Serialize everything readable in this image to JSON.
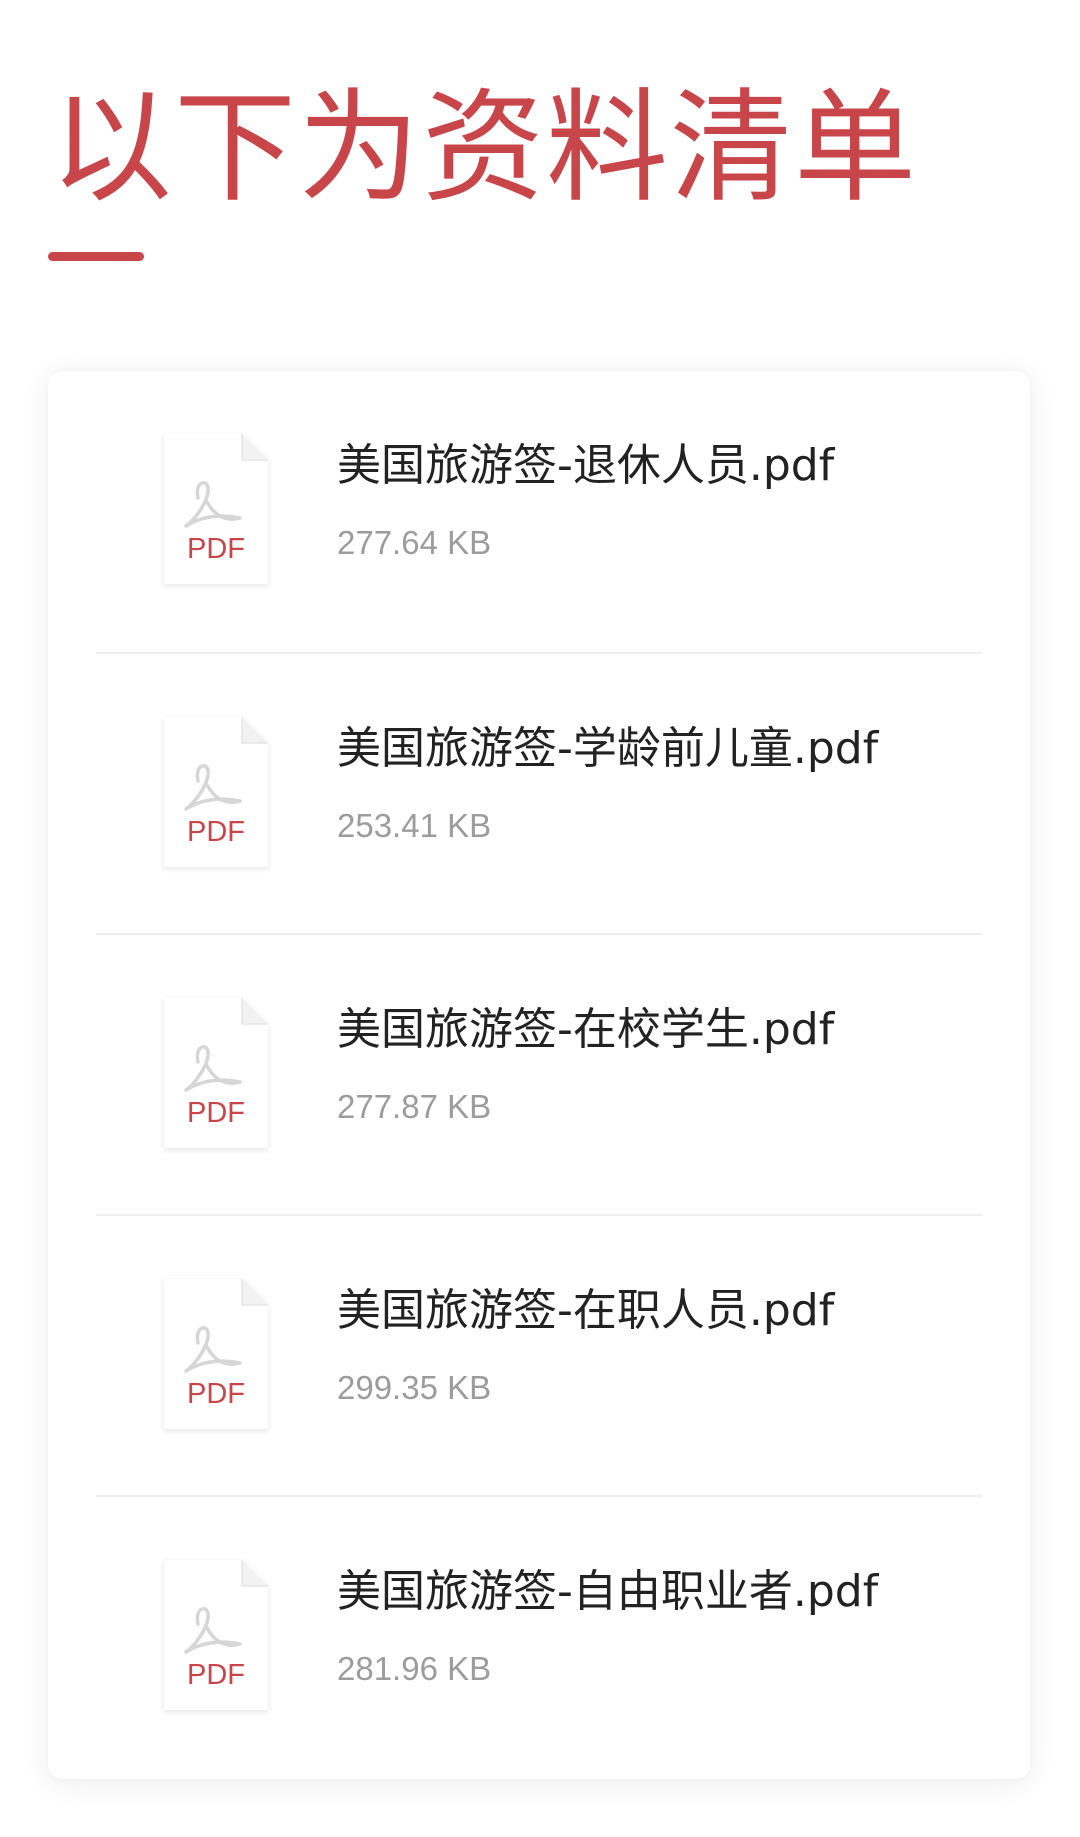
{
  "header": {
    "title": "以下为资料清单"
  },
  "colors": {
    "accent": "#c8454a",
    "pdf_label": "#c8454a",
    "file_size": "#9c9c9c",
    "file_name": "#222222"
  },
  "files": [
    {
      "name": "美国旅游签-退休人员.pdf",
      "size": "277.64 KB",
      "icon": "pdf-file-icon",
      "icon_label": "PDF"
    },
    {
      "name": "美国旅游签-学龄前儿童.pdf",
      "size": "253.41 KB",
      "icon": "pdf-file-icon",
      "icon_label": "PDF"
    },
    {
      "name": "美国旅游签-在校学生.pdf",
      "size": "277.87 KB",
      "icon": "pdf-file-icon",
      "icon_label": "PDF"
    },
    {
      "name": "美国旅游签-在职人员.pdf",
      "size": "299.35 KB",
      "icon": "pdf-file-icon",
      "icon_label": "PDF"
    },
    {
      "name": "美国旅游签-自由职业者.pdf",
      "size": "281.96 KB",
      "icon": "pdf-file-icon",
      "icon_label": "PDF"
    }
  ]
}
